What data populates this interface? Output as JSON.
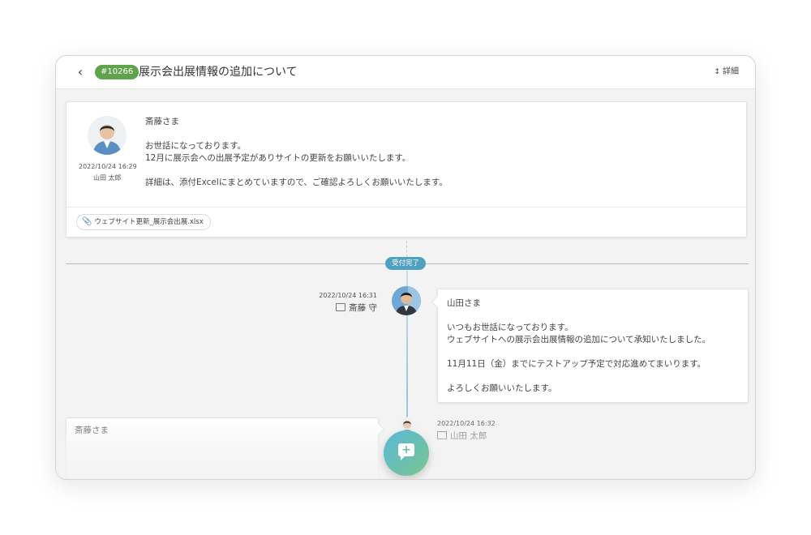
{
  "header": {
    "back_icon": "chevron-left-icon",
    "ticket_id": "#10266",
    "title": "展示会出展情報の追加について",
    "detail_label": "詳細",
    "detail_icon": "expand-vertical-icon"
  },
  "first_message": {
    "timestamp": "2022/10/24 16:29",
    "author": "山田 太郎",
    "body": "斎藤さま\n\nお世話になっております。\n12月に展示会への出展予定がありサイトの更新をお願いいたします。\n\n詳細は、添付Excelにまとめていますので、ご確認よろしくお願いいたします。",
    "attachment": "ウェブサイト更新_展示会出展.xlsx"
  },
  "status": {
    "label": "受付完了",
    "color": "#4fa1c2"
  },
  "reply": {
    "timestamp": "2022/10/24 16:31",
    "author": "斎藤 守",
    "body": "山田さま\n\nいつもお世話になっております。\nウェブサイトへの展示会出展情報の追加について承知いたしました。\n\n11月11日（金）までにテストアップ予定で対応進めてまいります。\n\nよろしくお願いいたします。"
  },
  "third_message": {
    "timestamp": "2022/10/24 16:32",
    "author": "山田 太郎",
    "body": "斎藤さま"
  },
  "fab": {
    "icon": "add-comment-icon"
  },
  "colors": {
    "badge_green": "#5fa34b",
    "fab_gradient_start": "#59b9d8",
    "fab_gradient_end": "#78c58f"
  }
}
